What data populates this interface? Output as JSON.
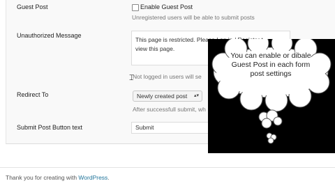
{
  "form": {
    "guest_post": {
      "label": "Guest Post",
      "checkbox_label": "Enable Guest Post",
      "description": "Unregistered users will be able to submit posts"
    },
    "unauthorized": {
      "label": "Unauthorized Message",
      "textarea_line1": "This page is restricted. Please Log in / Register t",
      "textarea_line2": "view this page.",
      "description": "Not logged in users will se"
    },
    "redirect": {
      "label": "Redirect To",
      "selected": "Newly created post",
      "description": "After successfull submit, wh"
    },
    "submit_text": {
      "label": "Submit Post Button text",
      "value": "Submit"
    }
  },
  "footer": {
    "prefix": "Thank you for creating with ",
    "link": "WordPress",
    "suffix": "."
  },
  "callout": {
    "text": "You can enable or dibale Guest Post in each form post settings"
  }
}
